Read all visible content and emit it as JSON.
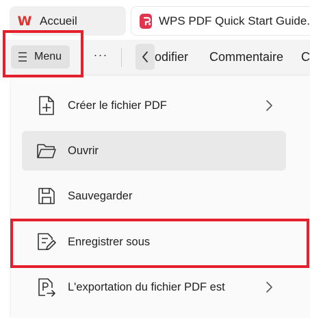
{
  "tabs": [
    {
      "label": "Accueil",
      "icon": "wps-logo-icon"
    },
    {
      "label": "WPS PDF Quick Start Guide.",
      "icon": "pdf-logo-icon"
    }
  ],
  "toolbar": {
    "menu_label": "Menu",
    "items": [
      "odifier",
      "Commentaire",
      "C"
    ]
  },
  "menu": {
    "items": [
      {
        "label": "Créer le fichier PDF",
        "icon": "new-file-icon",
        "submenu": true
      },
      {
        "label": "Ouvrir",
        "icon": "folder-open-icon",
        "submenu": false
      },
      {
        "label": "Sauvegarder",
        "icon": "save-icon",
        "submenu": false
      },
      {
        "label": "Enregistrer sous",
        "icon": "save-as-icon",
        "submenu": false
      },
      {
        "label": "L'exportation du fichier PDF est",
        "icon": "export-pdf-icon",
        "submenu": true
      }
    ]
  },
  "colors": {
    "highlight": "#e3202b",
    "wps_brand": "#e0322f",
    "pdf_brand": "#e0344f"
  }
}
